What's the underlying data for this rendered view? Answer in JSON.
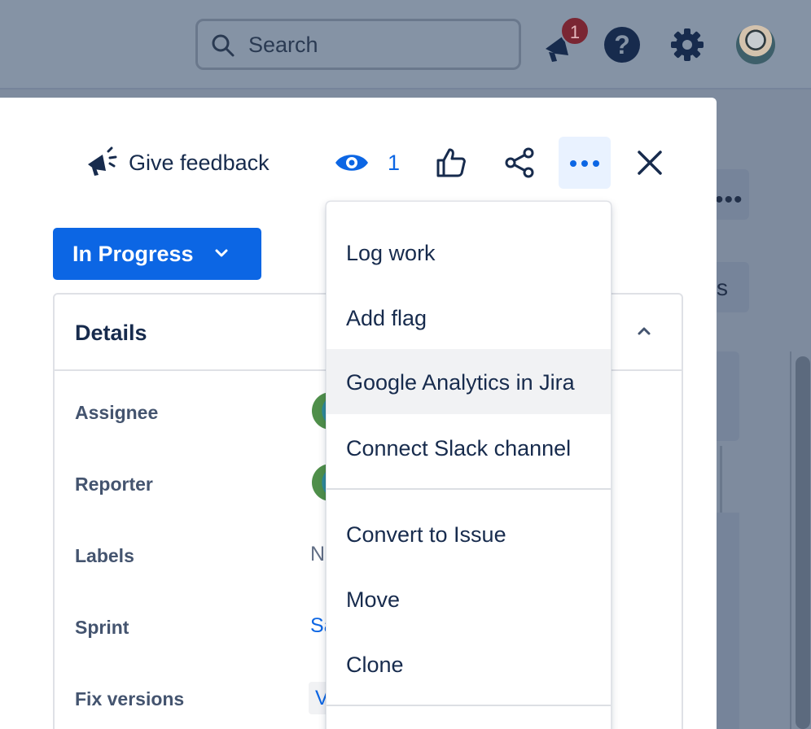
{
  "topbar": {
    "search": {
      "placeholder": "Search",
      "icon": "search-icon"
    },
    "notifications": {
      "icon": "megaphone-icon",
      "badge_count": "1"
    },
    "help": {
      "icon": "help-icon",
      "glyph": "?"
    },
    "settings": {
      "icon": "gear-icon"
    },
    "profile": {
      "icon": "avatar"
    }
  },
  "background": {
    "more_glyph": "•••",
    "partial_button_text": "s"
  },
  "issue_toolbar": {
    "feedback_label": "Give feedback",
    "watch_count": "1",
    "icons": [
      "megaphone-icon",
      "eye-icon",
      "thumbs-up-icon",
      "share-icon",
      "more-icon",
      "close-icon"
    ]
  },
  "status_button": {
    "label": "In Progress"
  },
  "details": {
    "title": "Details",
    "fields": [
      {
        "label": "Assignee"
      },
      {
        "label": "Reporter"
      },
      {
        "label": "Labels",
        "value_fragment": "N"
      },
      {
        "label": "Sprint",
        "value_fragment": "Sa"
      },
      {
        "label": "Fix versions",
        "value_fragment": "V"
      }
    ]
  },
  "more_menu": {
    "items": [
      {
        "label": "Log work"
      },
      {
        "label": "Add flag"
      },
      {
        "label": "Google Analytics in Jira",
        "highlighted": true
      },
      {
        "label": "Connect Slack channel"
      },
      {
        "label": "Convert to Issue"
      },
      {
        "label": "Move"
      },
      {
        "label": "Clone"
      }
    ]
  },
  "colors": {
    "primary": "#0c66e4",
    "text": "#172b4d",
    "subtle_text": "#44546f",
    "overlay": "#7e8b9e",
    "menu_hover": "#f1f2f4",
    "badge": "#7a2633"
  }
}
